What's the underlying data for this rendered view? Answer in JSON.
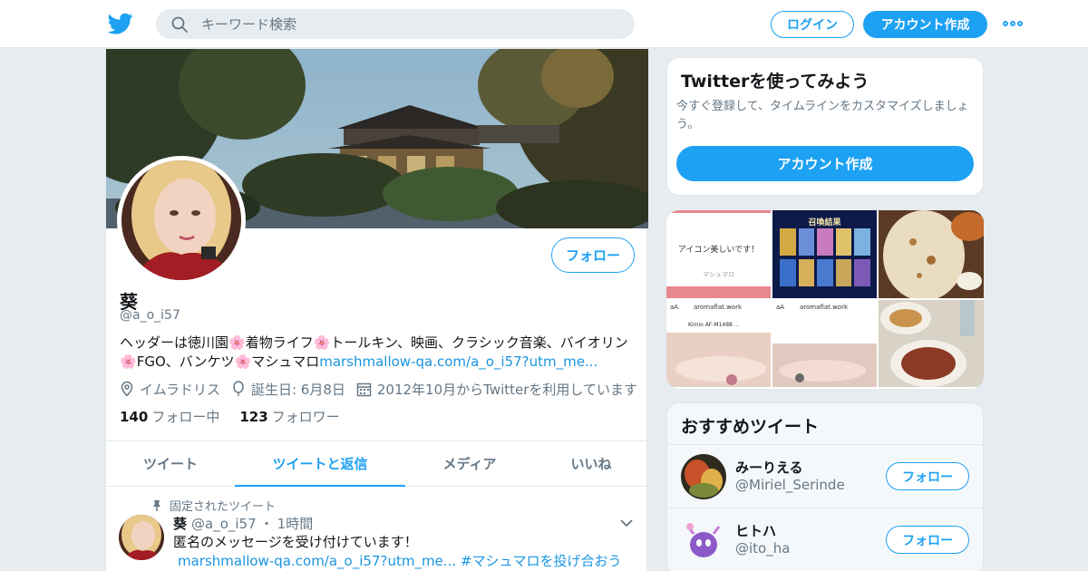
{
  "nav": {
    "search_placeholder": "キーワード検索",
    "login_label": "ログイン",
    "signup_label": "アカウント作成",
    "more_icon": "more-icon"
  },
  "profile": {
    "name": "葵",
    "handle": "@a_o_i57",
    "follow_label": "フォロー",
    "bio_parts": [
      "ヘッダーは徳川園",
      "着物ライフ",
      "トールキン、映画、クラシック音楽、バイオリン",
      "FGO、バンケツ",
      "マシュマロ"
    ],
    "bio_flower": "🌸",
    "bio_link": "marshmallow-qa.com/a_o_i57?utm_me...",
    "location": "イムラドリス",
    "birthday": "誕生日: 6月8日",
    "joined": "2012年10月からTwitterを利用しています",
    "following_count": "140",
    "following_label": "フォロー中",
    "followers_count": "123",
    "followers_label": "フォロワー"
  },
  "tabs": [
    {
      "label": "ツイート"
    },
    {
      "label": "ツイートと返信"
    },
    {
      "label": "メディア"
    },
    {
      "label": "いいね"
    }
  ],
  "tweet": {
    "pinned_label": "固定されたツイート",
    "name": "葵",
    "handle": "@a_o_i57",
    "time": "1時間",
    "text": "匿名のメッセージを受け付けています！",
    "link": "marshmallow-qa.com/a_o_i57?utm_me...",
    "hashtag": "#マシュマロを投げ合おう"
  },
  "signup_card": {
    "title": "Twitterを使ってみよう",
    "description": "今すぐ登録して、タイムラインをカスタマイズしましょう。",
    "button_label": "アカウント作成"
  },
  "media": {
    "tile1_text": "アイコン美しいです！",
    "tile1_sub": "マシュマロ",
    "tile2_title": "召喚結果",
    "tile4_url": "aromaflat.work",
    "tile5_url": "aromaflat.work",
    "tile4_product": "Kimio AF-M1488 ..."
  },
  "recommended": {
    "title": "おすすめツイート",
    "users": [
      {
        "name": "みーりえる",
        "handle": "@Miriel_Serinde",
        "button_label": "フォロー"
      },
      {
        "name": "ヒトハ",
        "handle": "@ito_ha",
        "button_label": "フォロー"
      }
    ]
  },
  "colors": {
    "accent": "#1da1f2",
    "link": "#1b95e0",
    "secondary_text": "#657786",
    "background": "#e6ecf0"
  }
}
